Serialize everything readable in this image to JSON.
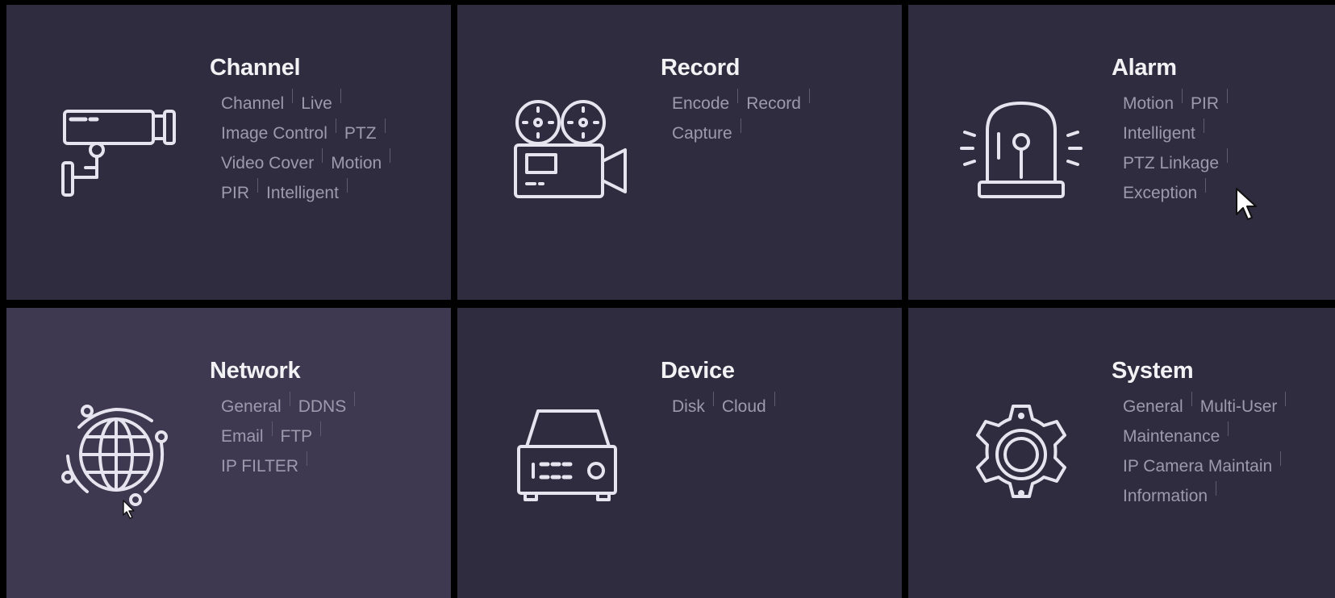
{
  "tiles": [
    {
      "title": "Channel",
      "icon": "cctv-camera-icon",
      "rows": [
        [
          "Channel",
          "Live"
        ],
        [
          "Image Control",
          "PTZ"
        ],
        [
          "Video Cover",
          "Motion"
        ],
        [
          "PIR",
          "Intelligent"
        ]
      ]
    },
    {
      "title": "Record",
      "icon": "movie-camera-icon",
      "rows": [
        [
          "Encode",
          "Record"
        ],
        [
          "Capture"
        ]
      ]
    },
    {
      "title": "Alarm",
      "icon": "alarm-siren-icon",
      "rows": [
        [
          "Motion",
          "PIR"
        ],
        [
          "Intelligent"
        ],
        [
          "PTZ Linkage"
        ],
        [
          "Exception"
        ]
      ]
    },
    {
      "title": "Network",
      "icon": "globe-network-icon",
      "rows": [
        [
          "General",
          "DDNS"
        ],
        [
          "Email",
          "FTP"
        ],
        [
          "IP FILTER"
        ]
      ]
    },
    {
      "title": "Device",
      "icon": "disk-drive-icon",
      "rows": [
        [
          "Disk",
          "Cloud"
        ]
      ]
    },
    {
      "title": "System",
      "icon": "gear-icon",
      "rows": [
        [
          "General",
          "Multi-User"
        ],
        [
          "Maintenance"
        ],
        [
          "IP Camera Maintain"
        ],
        [
          "Information"
        ]
      ]
    }
  ],
  "colors": {
    "tile_bg": "#2f2c3f",
    "tile_hover_bg": "#3e3950",
    "title": "#f2f2f4",
    "link": "#9e9aae",
    "grid_lines": "#000000"
  }
}
